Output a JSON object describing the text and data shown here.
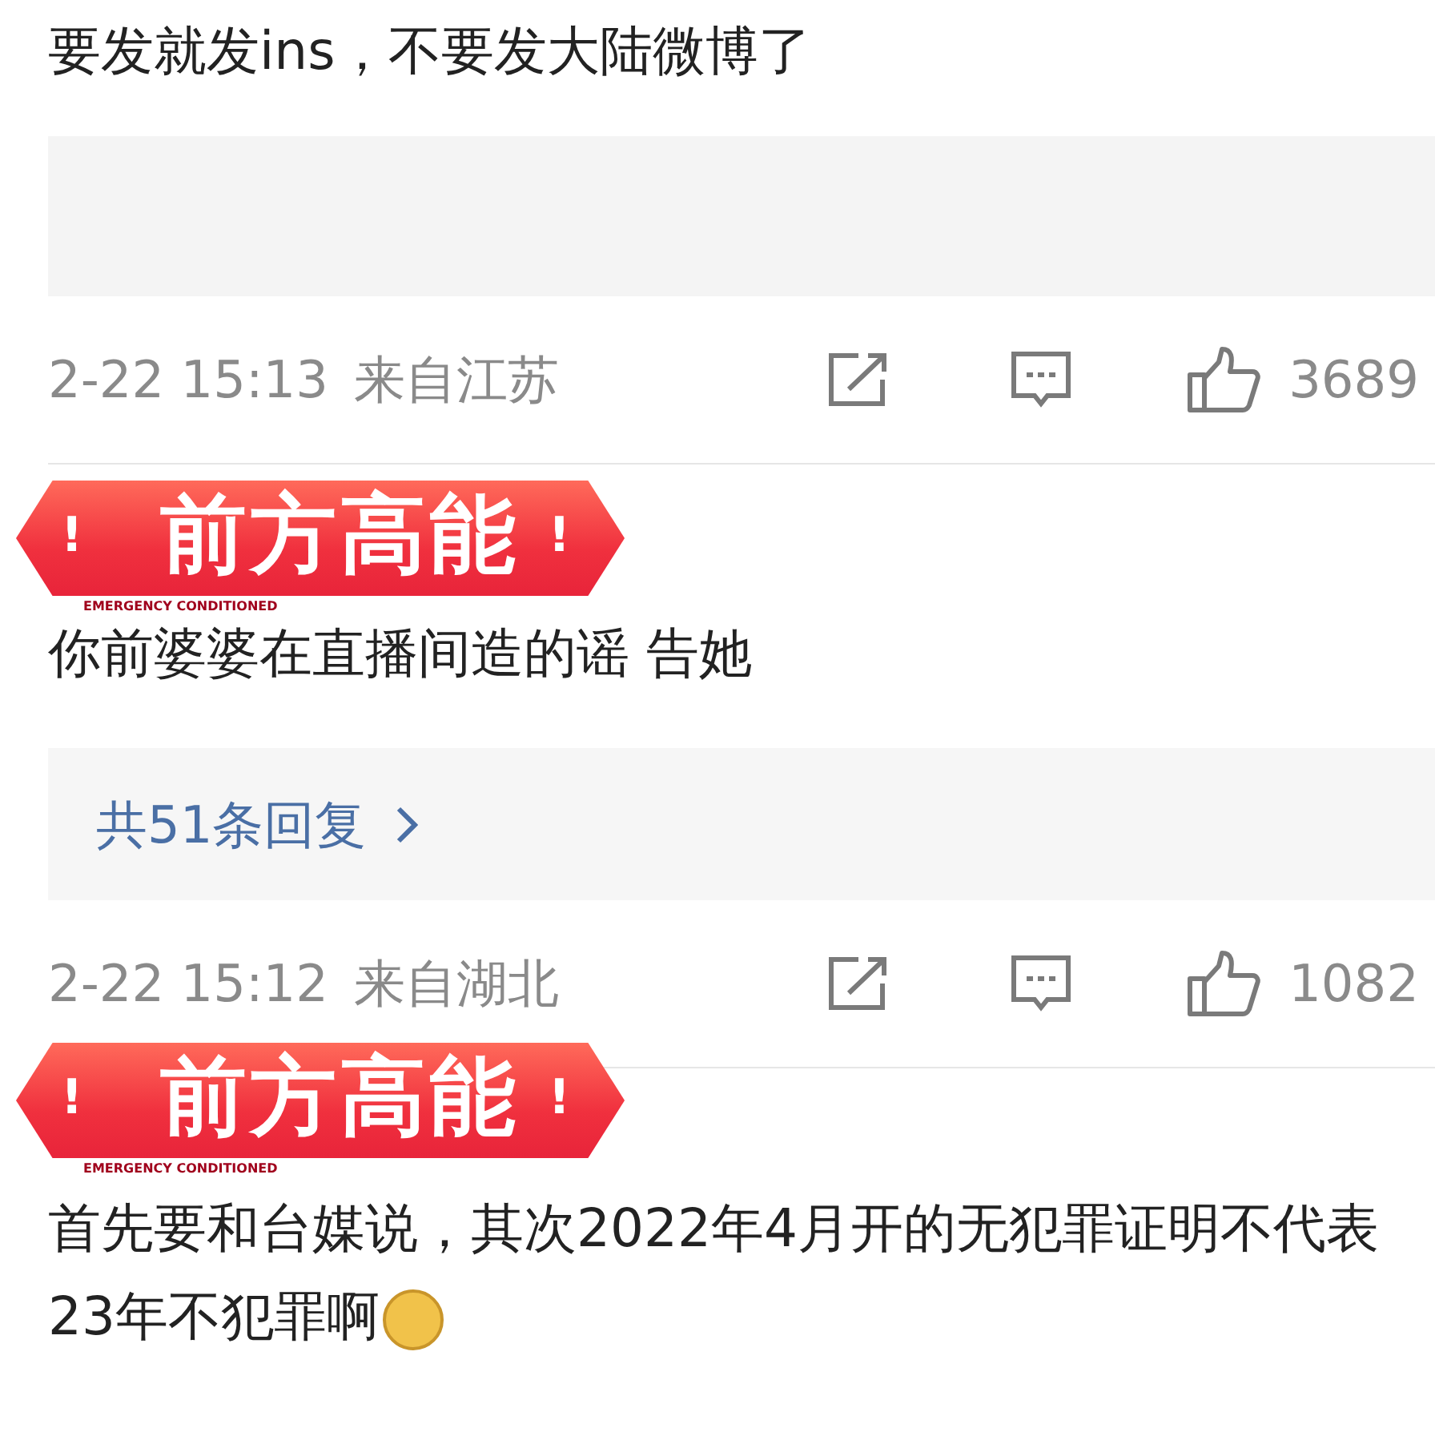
{
  "comments": [
    {
      "text": "要发就发ins，不要发大陆微博了",
      "has_media": true,
      "meta": {
        "time": "2-22 15:13",
        "location": "来自江苏",
        "likes": "3689"
      }
    },
    {
      "sticker": {
        "title": "前方高能",
        "mark": "!",
        "caption": "EMERGENCY CONDITIONED"
      },
      "text": "你前婆婆在直播间造的谣  告她",
      "replies": "共51条回复",
      "meta": {
        "time": "2-22 15:12",
        "location": "来自湖北",
        "likes": "1082"
      }
    },
    {
      "sticker": {
        "title": "前方高能",
        "mark": "!",
        "caption": "EMERGENCY CONDITIONED"
      },
      "text": "首先要和台媒说，其次2022年4月开的无犯罪证明不代表23年不犯罪啊",
      "trailing_emoji": true
    }
  ]
}
